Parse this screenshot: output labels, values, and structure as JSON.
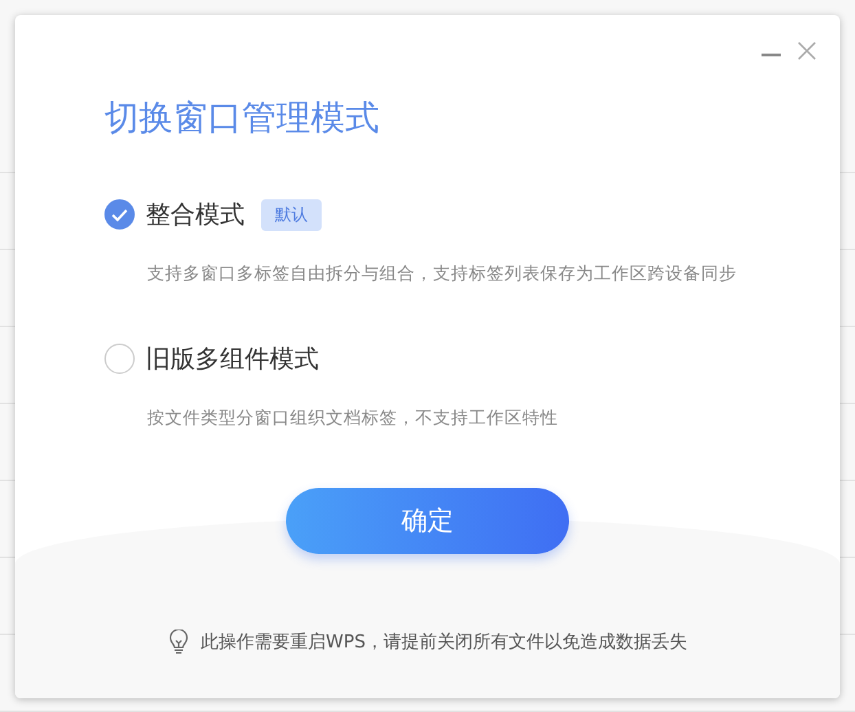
{
  "dialog": {
    "title": "切换窗口管理模式",
    "options": [
      {
        "label": "整合模式",
        "badge": "默认",
        "description": "支持多窗口多标签自由拆分与组合，支持标签列表保存为工作区跨设备同步",
        "selected": true
      },
      {
        "label": "旧版多组件模式",
        "description": "按文件类型分窗口组织文档标签，不支持工作区特性",
        "selected": false
      }
    ],
    "confirm_button": "确定",
    "notice": "此操作需要重启WPS，请提前关闭所有文件以免造成数据丢失"
  }
}
